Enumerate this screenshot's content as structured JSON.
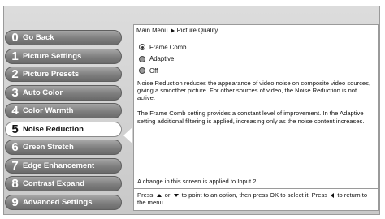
{
  "menu": {
    "items": [
      {
        "num": "0",
        "label": "Go Back"
      },
      {
        "num": "1",
        "label": "Picture Settings"
      },
      {
        "num": "2",
        "label": "Picture Presets"
      },
      {
        "num": "3",
        "label": "Auto Color"
      },
      {
        "num": "4",
        "label": "Color Warmth"
      },
      {
        "num": "5",
        "label": "Noise Reduction",
        "selected": true
      },
      {
        "num": "6",
        "label": "Green Stretch"
      },
      {
        "num": "7",
        "label": "Edge Enhancement"
      },
      {
        "num": "8",
        "label": "Contrast Expand"
      },
      {
        "num": "9",
        "label": "Advanced Settings"
      }
    ]
  },
  "panel": {
    "breadcrumb": {
      "root": "Main Menu",
      "current": "Picture Quality"
    },
    "options": [
      {
        "label": "Frame Comb",
        "selected": true
      },
      {
        "label": "Adaptive",
        "selected": false
      },
      {
        "label": "Off",
        "selected": false
      }
    ],
    "description": {
      "para1": "Noise Reduction reduces the appearance of video noise on composite video sources, giving a smoother picture. For other sources of video, the Noise Reduction is not active.",
      "para2": "The Frame Comb setting provides a constant level of improvement. In the Adaptive setting additional filtering is applied, increasing only as the noise content increases."
    },
    "notice": "A change in this screen is applied to Input 2.",
    "footer": {
      "part1": "Press",
      "or": "or",
      "part2": "to point to an option, then press OK to select it. Press",
      "part3": "to return to the menu."
    }
  }
}
